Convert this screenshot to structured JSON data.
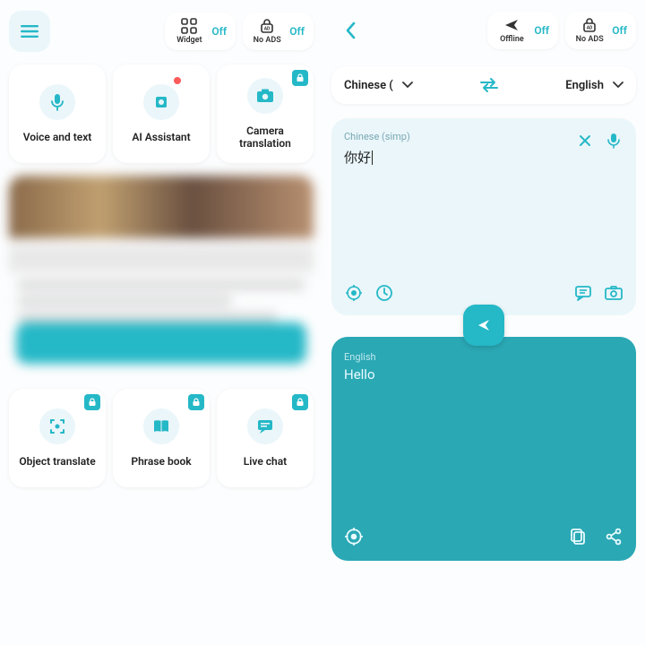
{
  "left": {
    "toggles": {
      "widget": {
        "label": "Widget",
        "state": "Off"
      },
      "noads": {
        "label": "No ADS",
        "state": "Off"
      }
    },
    "features_top": [
      {
        "title": "Voice and text"
      },
      {
        "title": "AI Assistant"
      },
      {
        "title": "Camera translation"
      }
    ],
    "features_bottom": [
      {
        "title": "Object translate"
      },
      {
        "title": "Phrase book"
      },
      {
        "title": "Live chat"
      }
    ]
  },
  "right": {
    "toggles": {
      "offline": {
        "label": "Offline",
        "state": "Off"
      },
      "noads": {
        "label": "No ADS",
        "state": "Off"
      }
    },
    "source_lang_short": "Chinese (",
    "target_lang": "English",
    "input": {
      "lang_label": "Chinese (simp)",
      "text": "你好"
    },
    "output": {
      "lang_label": "English",
      "text": "Hello"
    }
  }
}
